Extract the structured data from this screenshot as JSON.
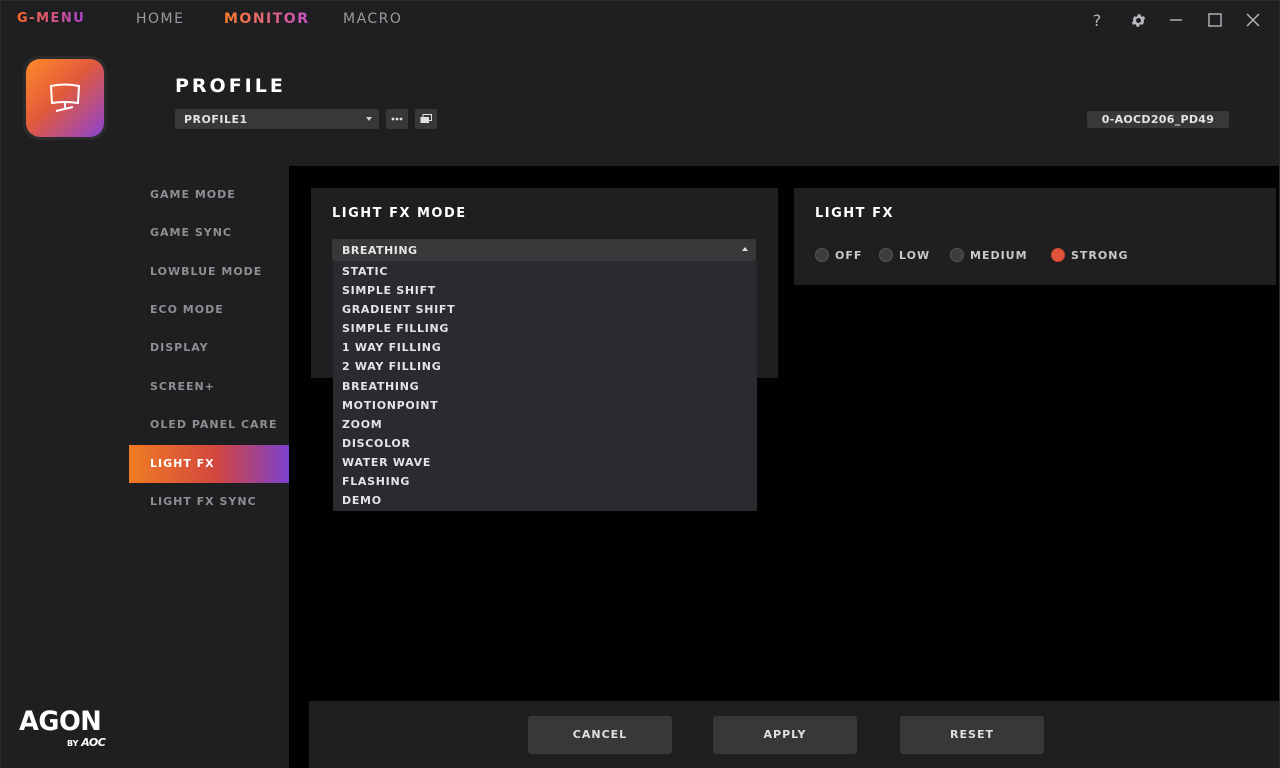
{
  "titlebar": {
    "brand": "G-MENU",
    "tabs": [
      {
        "label": "HOME"
      },
      {
        "label": "MONITOR"
      },
      {
        "label": "MACRO"
      }
    ],
    "help_label": "?"
  },
  "rail": {
    "agon_word": "AGON",
    "agon_by": "BY",
    "agon_brand": "AOC"
  },
  "header": {
    "title": "PROFILE",
    "profile_value": "PROFILE1",
    "device_id": "0-AOCD206_PD49"
  },
  "sidemenu": {
    "items": [
      {
        "label": "GAME MODE"
      },
      {
        "label": "GAME SYNC"
      },
      {
        "label": "LOWBLUE MODE"
      },
      {
        "label": "ECO MODE"
      },
      {
        "label": "DISPLAY"
      },
      {
        "label": "SCREEN+"
      },
      {
        "label": "OLED PANEL CARE"
      },
      {
        "label": "LIGHT FX"
      },
      {
        "label": "LIGHT FX SYNC"
      }
    ],
    "active": "LIGHT FX"
  },
  "light_fx_mode": {
    "title": "LIGHT FX MODE",
    "selected": "BREATHING",
    "options": [
      "STATIC",
      "SIMPLE SHIFT",
      "GRADIENT SHIFT",
      "SIMPLE FILLING",
      "1 WAY FILLING",
      "2 WAY FILLING",
      "BREATHING",
      "MOTIONPOINT",
      "ZOOM",
      "DISCOLOR",
      "WATER WAVE",
      "FLASHING",
      "DEMO"
    ]
  },
  "light_fx": {
    "title": "LIGHT FX",
    "options": [
      "OFF",
      "LOW",
      "MEDIUM",
      "STRONG"
    ],
    "selected": "STRONG"
  },
  "footer": {
    "cancel": "CANCEL",
    "apply": "APPLY",
    "reset": "RESET"
  },
  "colors": {
    "accent_orange": "#f07c24",
    "accent_purple": "#7c40cf",
    "radio_on": "#e0553a"
  }
}
